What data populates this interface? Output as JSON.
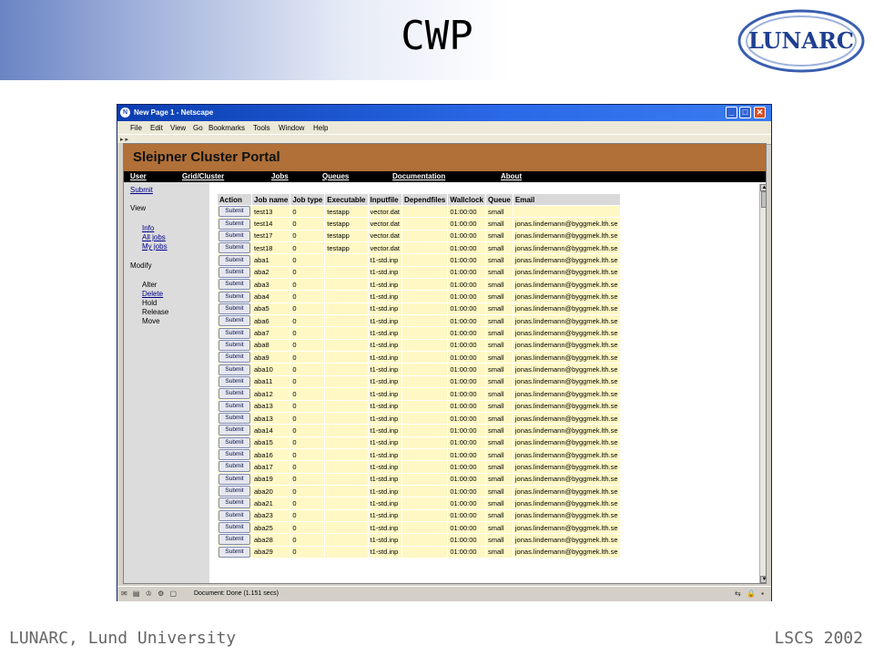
{
  "slide": {
    "title": "CWP",
    "logo_text": "LUNARC",
    "footer_left": "LUNARC, Lund University",
    "footer_right": "LSCS 2002"
  },
  "window": {
    "title": "New Page 1 - Netscape",
    "menu": [
      "File",
      "Edit",
      "View",
      "Go",
      "Bookmarks",
      "Tools",
      "Window",
      "Help"
    ],
    "status_text": "Document: Done (1.151 secs)"
  },
  "portal": {
    "banner": "Sleipner Cluster Portal",
    "nav": [
      "User",
      "Grid/Cluster",
      "Jobs",
      "Queues",
      "Documentation",
      "About"
    ],
    "side": {
      "submit": "Submit",
      "view_heading": "View",
      "view_links": [
        "Info",
        "All jobs",
        "My jobs"
      ],
      "modify_heading": "Modify",
      "modify_items": [
        {
          "label": "Alter",
          "link": false
        },
        {
          "label": "Delete",
          "link": true
        },
        {
          "label": "Hold",
          "link": false
        },
        {
          "label": "Release",
          "link": false
        },
        {
          "label": "Move",
          "link": false
        }
      ]
    },
    "table": {
      "button_label": "Submit",
      "headers": [
        "Action",
        "Job name",
        "Job type",
        "Executable",
        "Inputfile",
        "Dependfiles",
        "Wallclock",
        "Queue",
        "Email"
      ],
      "rows": [
        [
          "test13",
          "0",
          "testapp",
          "vector.dat",
          "",
          "01:00:00",
          "small",
          ""
        ],
        [
          "test14",
          "0",
          "testapp",
          "vector.dat",
          "",
          "01:00:00",
          "small",
          "jonas.lindemann@byggmek.lth.se"
        ],
        [
          "test17",
          "0",
          "testapp",
          "vector.dat",
          "",
          "01:00:00",
          "small",
          "jonas.lindemann@byggmek.lth.se"
        ],
        [
          "test18",
          "0",
          "testapp",
          "vector.dat",
          "",
          "01:00:00",
          "small",
          "jonas.lindemann@byggmek.lth.se"
        ],
        [
          "aba1",
          "0",
          "",
          "t1-std.inp",
          "",
          "01:00:00",
          "small",
          "jonas.lindemann@byggmek.lth.se"
        ],
        [
          "aba2",
          "0",
          "",
          "t1-std.inp",
          "",
          "01:00:00",
          "small",
          "jonas.lindemann@byggmek.lth.se"
        ],
        [
          "aba3",
          "0",
          "",
          "t1-std.inp",
          "",
          "01:00:00",
          "small",
          "jonas.lindemann@byggmek.lth.se"
        ],
        [
          "aba4",
          "0",
          "",
          "t1-std.inp",
          "",
          "01:00:00",
          "small",
          "jonas.lindemann@byggmek.lth.se"
        ],
        [
          "aba5",
          "0",
          "",
          "t1-std.inp",
          "",
          "01:00:00",
          "small",
          "jonas.lindemann@byggmek.lth.se"
        ],
        [
          "aba6",
          "0",
          "",
          "t1-std.inp",
          "",
          "01:00:00",
          "small",
          "jonas.lindemann@byggmek.lth.se"
        ],
        [
          "aba7",
          "0",
          "",
          "t1-std.inp",
          "",
          "01:00:00",
          "small",
          "jonas.lindemann@byggmek.lth.se"
        ],
        [
          "aba8",
          "0",
          "",
          "t1-std.inp",
          "",
          "01:00:00",
          "small",
          "jonas.lindemann@byggmek.lth.se"
        ],
        [
          "aba9",
          "0",
          "",
          "t1-std.inp",
          "",
          "01:00:00",
          "small",
          "jonas.lindemann@byggmek.lth.se"
        ],
        [
          "aba10",
          "0",
          "",
          "t1-std.inp",
          "",
          "01:00:00",
          "small",
          "jonas.lindemann@byggmek.lth.se"
        ],
        [
          "aba11",
          "0",
          "",
          "t1-std.inp",
          "",
          "01:00:00",
          "small",
          "jonas.lindemann@byggmek.lth.se"
        ],
        [
          "aba12",
          "0",
          "",
          "t1-std.inp",
          "",
          "01:00:00",
          "small",
          "jonas.lindemann@byggmek.lth.se"
        ],
        [
          "aba13",
          "0",
          "",
          "t1-std.inp",
          "",
          "01:00:00",
          "small",
          "jonas.lindemann@byggmek.lth.se"
        ],
        [
          "aba13",
          "0",
          "",
          "t1-std.inp",
          "",
          "01:00:00",
          "small",
          "jonas.lindemann@byggmek.lth.se"
        ],
        [
          "aba14",
          "0",
          "",
          "t1-std.inp",
          "",
          "01:00:00",
          "small",
          "jonas.lindemann@byggmek.lth.se"
        ],
        [
          "aba15",
          "0",
          "",
          "t1-std.inp",
          "",
          "01:00:00",
          "small",
          "jonas.lindemann@byggmek.lth.se"
        ],
        [
          "aba16",
          "0",
          "",
          "t1-std.inp",
          "",
          "01:00:00",
          "small",
          "jonas.lindemann@byggmek.lth.se"
        ],
        [
          "aba17",
          "0",
          "",
          "t1-std.inp",
          "",
          "01:00:00",
          "small",
          "jonas.lindemann@byggmek.lth.se"
        ],
        [
          "aba19",
          "0",
          "",
          "t1-std.inp",
          "",
          "01:00:00",
          "small",
          "jonas.lindemann@byggmek.lth.se"
        ],
        [
          "aba20",
          "0",
          "",
          "t1-std.inp",
          "",
          "01:00:00",
          "small",
          "jonas.lindemann@byggmek.lth.se"
        ],
        [
          "aba21",
          "0",
          "",
          "t1-std.inp",
          "",
          "01:00:00",
          "small",
          "jonas.lindemann@byggmek.lth.se"
        ],
        [
          "aba23",
          "0",
          "",
          "t1-std.inp",
          "",
          "01:00:00",
          "small",
          "jonas.lindemann@byggmek.lth.se"
        ],
        [
          "aba25",
          "0",
          "",
          "t1-std.inp",
          "",
          "01:00:00",
          "small",
          "jonas.lindemann@byggmek.lth.se"
        ],
        [
          "aba28",
          "0",
          "",
          "t1-std.inp",
          "",
          "01:00:00",
          "small",
          "jonas.lindemann@byggmek.lth.se"
        ],
        [
          "aba29",
          "0",
          "",
          "t1-std.inp",
          "",
          "01:00:00",
          "small",
          "jonas.lindemann@byggmek.lth.se"
        ]
      ]
    }
  },
  "colors": {
    "banner": "#b07038",
    "navbar": "#000000",
    "cell": "#fff8c4",
    "header_cell": "#d9d9d9",
    "titlebar": "#0a3db0"
  }
}
